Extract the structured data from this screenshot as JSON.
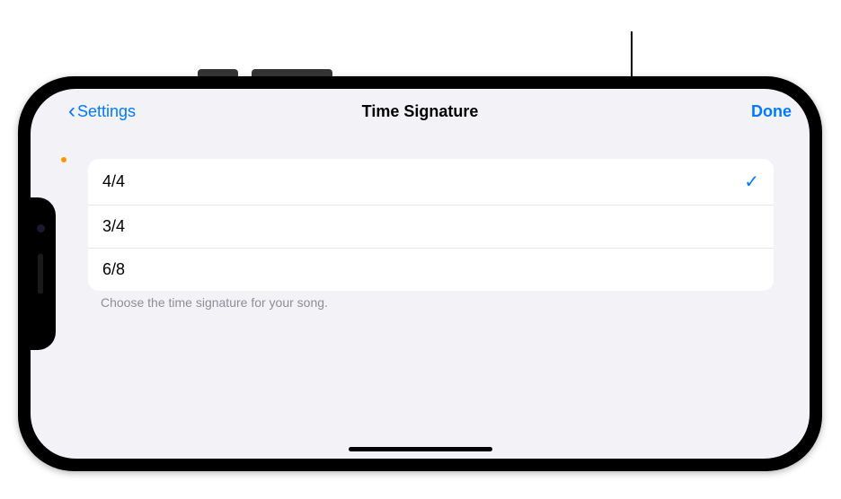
{
  "nav": {
    "back_label": "Settings",
    "title": "Time Signature",
    "done_label": "Done"
  },
  "options": [
    {
      "label": "4/4",
      "selected": true
    },
    {
      "label": "3/4",
      "selected": false
    },
    {
      "label": "6/8",
      "selected": false
    }
  ],
  "footer": "Choose the time signature for your song."
}
